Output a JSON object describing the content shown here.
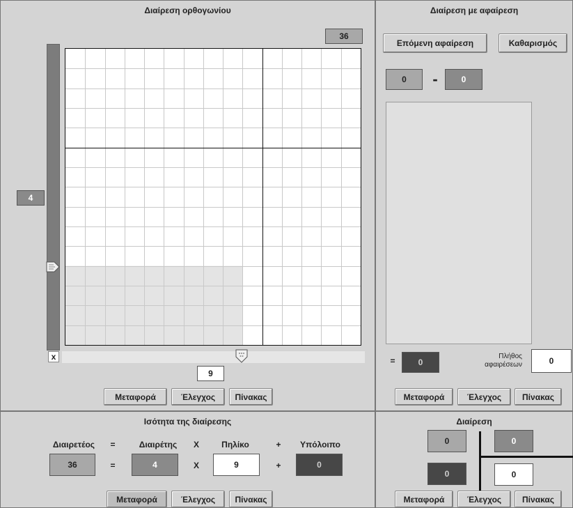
{
  "rect_panel": {
    "title": "Διαίρεση ορθογωνίου",
    "product_value": "36",
    "vertical_value": "4",
    "horizontal_value": "9",
    "x_label": "x",
    "buttons": {
      "transfer": "Μεταφορά",
      "check": "Έλεγχος",
      "table": "Πίνακας"
    },
    "grid": {
      "cols": 15,
      "rows": 15,
      "shaded_cols": 9,
      "shaded_rows": 4
    }
  },
  "subtraction_panel": {
    "title": "Διαίρεση με αφαίρεση",
    "next_button": "Επόμενη αφαίρεση",
    "clear_button": "Καθαρισμός",
    "left_value": "0",
    "minus": "-",
    "right_value": "0",
    "equals": "=",
    "result_value": "0",
    "count_label_1": "Πλήθος",
    "count_label_2": "αφαιρέσεων",
    "count_value": "0",
    "buttons": {
      "transfer": "Μεταφορά",
      "check": "Έλεγχος",
      "table": "Πίνακας"
    }
  },
  "equation_panel": {
    "title": "Ισότητα της διαίρεσης",
    "headers": {
      "dividend": "Διαιρετέος",
      "divisor": "Διαιρέτης",
      "quotient": "Πηλίκο",
      "remainder": "Υπόλοιπο"
    },
    "ops": {
      "eq": "=",
      "times": "X",
      "plus": "+"
    },
    "values": {
      "dividend": "36",
      "divisor": "4",
      "quotient": "9",
      "remainder": "0"
    },
    "buttons": {
      "transfer": "Μεταφορά",
      "check": "Έλεγχος",
      "table": "Πίνακας"
    }
  },
  "division_panel": {
    "title": "Διαίρεση",
    "dividend": "0",
    "divisor": "0",
    "remainder": "0",
    "quotient": "0",
    "buttons": {
      "transfer": "Μεταφορά",
      "check": "Έλεγχος",
      "table": "Πίνακας"
    }
  }
}
